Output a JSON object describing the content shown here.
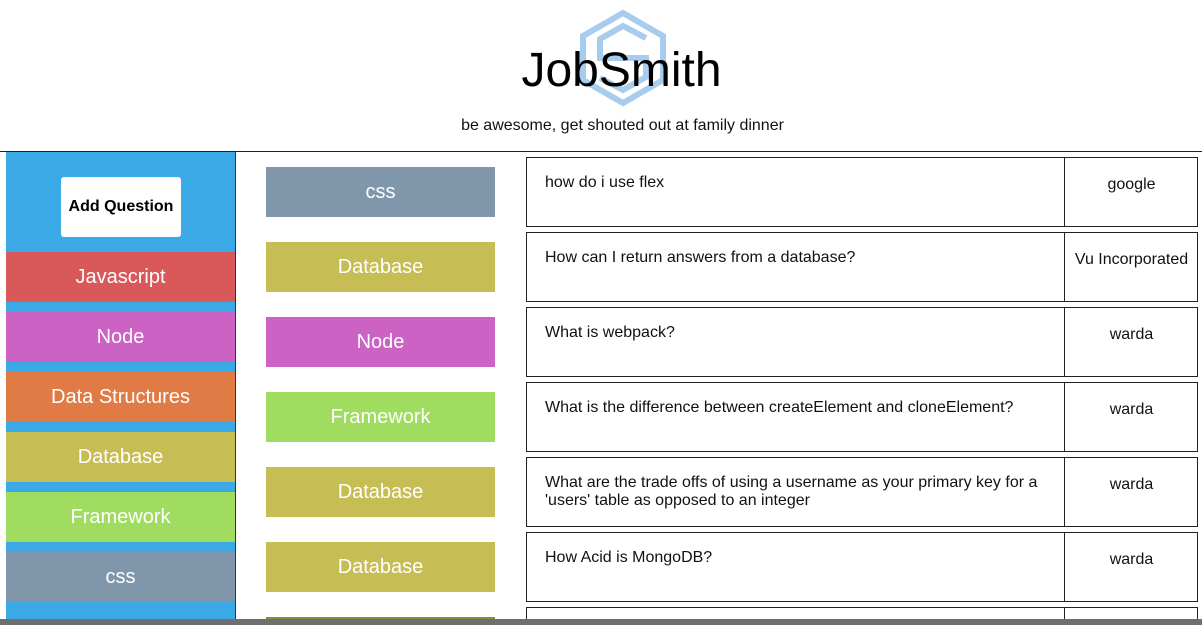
{
  "header": {
    "title": "JobSmith",
    "subtitle": "be awesome, get shouted out at family dinner",
    "logo_icon": "hexagon-s-logo-icon"
  },
  "colors": {
    "sidebar_bg": "#3aa9e6",
    "javascript": "#d9585a",
    "node": "#cc62c4",
    "data_structures": "#e07b45",
    "database": "#c7bd55",
    "framework": "#9fdc5f",
    "css": "#8097ab"
  },
  "sidebar": {
    "add_button_label": "Add Question",
    "categories": [
      {
        "label": "Javascript",
        "color": "#d9585a"
      },
      {
        "label": "Node",
        "color": "#cc62c4"
      },
      {
        "label": "Data Structures",
        "color": "#e07b45"
      },
      {
        "label": "Database",
        "color": "#c7bd55"
      },
      {
        "label": "Framework",
        "color": "#9fdc5f"
      },
      {
        "label": "css",
        "color": "#8097ab"
      }
    ]
  },
  "questions": [
    {
      "tag": "css",
      "tag_color": "#8097ab",
      "text": "how do i use flex",
      "author": "google"
    },
    {
      "tag": "Database",
      "tag_color": "#c7bd55",
      "text": "How can I return answers from a database?",
      "author": "Vu Incorporated"
    },
    {
      "tag": "Node",
      "tag_color": "#cc62c4",
      "text": "What is webpack?",
      "author": "warda"
    },
    {
      "tag": "Framework",
      "tag_color": "#9fdc5f",
      "text": "What is the difference between createElement and cloneElement?",
      "author": "warda"
    },
    {
      "tag": "Database",
      "tag_color": "#c7bd55",
      "text": "What are the trade offs of using a username as your primary key for a 'users' table as opposed to an integer",
      "author": "warda"
    },
    {
      "tag": "Database",
      "tag_color": "#c7bd55",
      "text": "How Acid is MongoDB?",
      "author": "warda"
    }
  ]
}
